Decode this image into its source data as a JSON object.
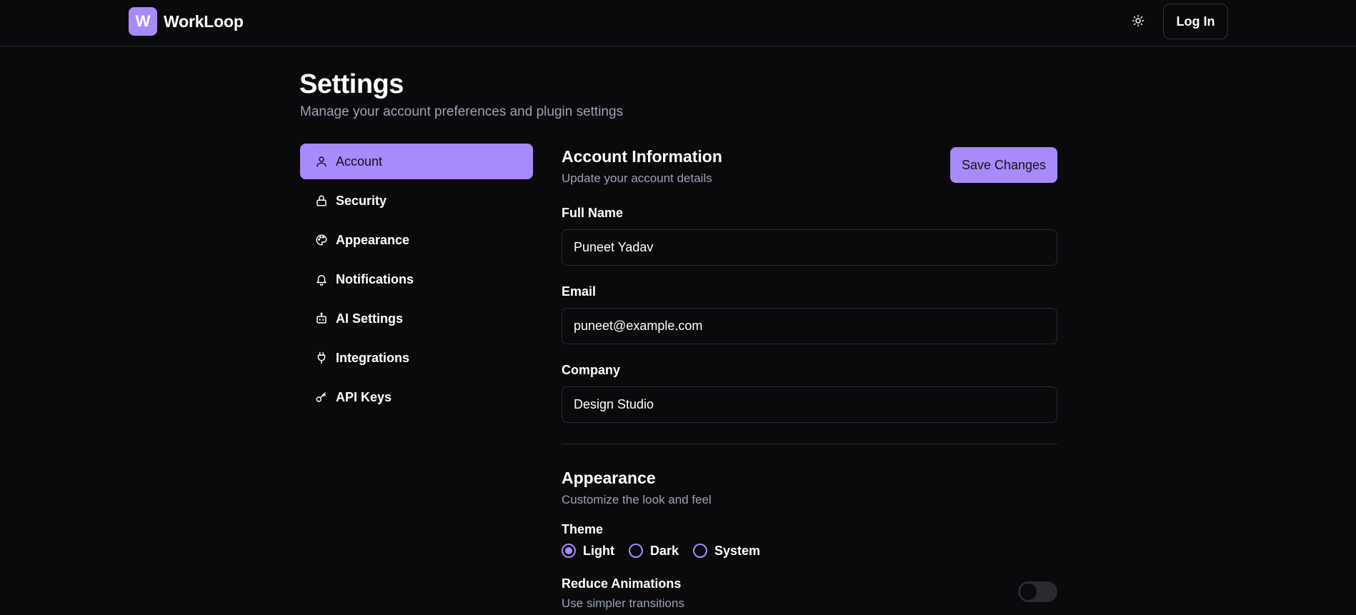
{
  "app": {
    "logo_letter": "W",
    "name": "WorkLoop"
  },
  "nav": {
    "login_label": "Log In",
    "theme_icon": "sun-icon"
  },
  "header": {
    "title": "Settings",
    "subtitle": "Manage your account preferences and plugin settings"
  },
  "sidebar": {
    "items": [
      {
        "label": "Account",
        "icon": "user-icon",
        "active": true
      },
      {
        "label": "Security",
        "icon": "lock-icon"
      },
      {
        "label": "Appearance",
        "icon": "palette-icon"
      },
      {
        "label": "Notifications",
        "icon": "bell-icon"
      },
      {
        "label": "AI Settings",
        "icon": "bot-icon"
      },
      {
        "label": "Integrations",
        "icon": "plug-icon"
      },
      {
        "label": "API Keys",
        "icon": "key-icon"
      }
    ]
  },
  "account": {
    "title": "Account Information",
    "subtitle": "Update your account details",
    "save_label": "Save Changes",
    "fields": {
      "full_name": {
        "label": "Full Name",
        "value": "Puneet Yadav"
      },
      "email": {
        "label": "Email",
        "value": "puneet@example.com"
      },
      "company": {
        "label": "Company",
        "value": "Design Studio"
      }
    }
  },
  "appearance": {
    "title": "Appearance",
    "subtitle": "Customize the look and feel",
    "theme_label": "Theme",
    "theme_options": [
      "Light",
      "Dark",
      "System"
    ],
    "theme_selected": "Light",
    "reduce_animations": {
      "label": "Reduce Animations",
      "description": "Use simpler transitions",
      "enabled": false
    }
  },
  "colors": {
    "accent": "#a78bfa",
    "background": "#0a0a0c",
    "muted_text": "#9aa3b5"
  }
}
